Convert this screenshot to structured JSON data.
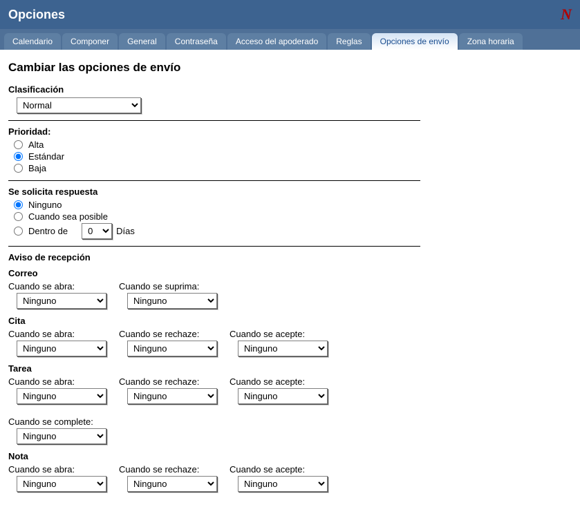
{
  "header": {
    "title": "Opciones",
    "logo": "N"
  },
  "tabs": [
    {
      "label": "Calendario",
      "name": "tab-calendario"
    },
    {
      "label": "Componer",
      "name": "tab-componer"
    },
    {
      "label": "General",
      "name": "tab-general"
    },
    {
      "label": "Contraseña",
      "name": "tab-contrasena"
    },
    {
      "label": "Acceso del apoderado",
      "name": "tab-acceso-apoderado"
    },
    {
      "label": "Reglas",
      "name": "tab-reglas"
    },
    {
      "label": "Opciones de envío",
      "name": "tab-opciones-envio"
    },
    {
      "label": "Zona horaria",
      "name": "tab-zona-horaria"
    }
  ],
  "page": {
    "heading": "Cambiar las opciones de envío",
    "classification": {
      "label": "Clasificación",
      "value": "Normal"
    },
    "priority": {
      "label": "Prioridad:",
      "options": {
        "high": "Alta",
        "standard": "Estándar",
        "low": "Baja"
      }
    },
    "reply": {
      "label": "Se solicita respuesta",
      "none": "Ninguno",
      "when_convenient": "Cuando sea posible",
      "within": "Dentro de",
      "days_value": "0",
      "days_label": "Días"
    },
    "receipt": {
      "label": "Aviso de recepción",
      "when_opened": "Cuando se abra:",
      "when_deleted": "Cuando se suprima:",
      "when_declined": "Cuando se rechaze:",
      "when_accepted": "Cuando se acepte:",
      "when_completed": "Cuando se complete:",
      "value_none": "Ninguno",
      "mail": {
        "title": "Correo"
      },
      "appointment": {
        "title": "Cita"
      },
      "task": {
        "title": "Tarea"
      },
      "note": {
        "title": "Nota"
      }
    }
  }
}
